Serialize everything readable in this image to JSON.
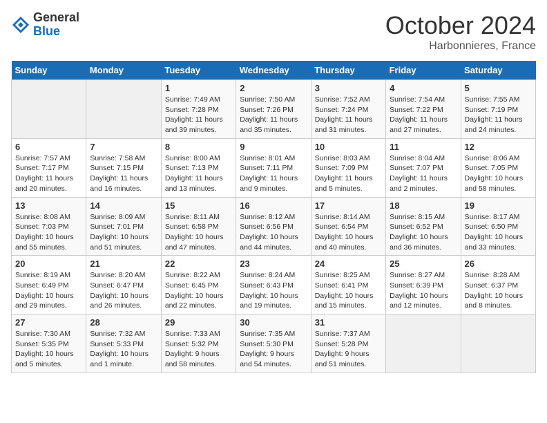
{
  "header": {
    "logo_general": "General",
    "logo_blue": "Blue",
    "month": "October 2024",
    "location": "Harbonnieres, France"
  },
  "days_of_week": [
    "Sunday",
    "Monday",
    "Tuesday",
    "Wednesday",
    "Thursday",
    "Friday",
    "Saturday"
  ],
  "weeks": [
    [
      {
        "day": "",
        "sunrise": "",
        "sunset": "",
        "daylight": ""
      },
      {
        "day": "",
        "sunrise": "",
        "sunset": "",
        "daylight": ""
      },
      {
        "day": "1",
        "sunrise": "Sunrise: 7:49 AM",
        "sunset": "Sunset: 7:28 PM",
        "daylight": "Daylight: 11 hours and 39 minutes."
      },
      {
        "day": "2",
        "sunrise": "Sunrise: 7:50 AM",
        "sunset": "Sunset: 7:26 PM",
        "daylight": "Daylight: 11 hours and 35 minutes."
      },
      {
        "day": "3",
        "sunrise": "Sunrise: 7:52 AM",
        "sunset": "Sunset: 7:24 PM",
        "daylight": "Daylight: 11 hours and 31 minutes."
      },
      {
        "day": "4",
        "sunrise": "Sunrise: 7:54 AM",
        "sunset": "Sunset: 7:22 PM",
        "daylight": "Daylight: 11 hours and 27 minutes."
      },
      {
        "day": "5",
        "sunrise": "Sunrise: 7:55 AM",
        "sunset": "Sunset: 7:19 PM",
        "daylight": "Daylight: 11 hours and 24 minutes."
      }
    ],
    [
      {
        "day": "6",
        "sunrise": "Sunrise: 7:57 AM",
        "sunset": "Sunset: 7:17 PM",
        "daylight": "Daylight: 11 hours and 20 minutes."
      },
      {
        "day": "7",
        "sunrise": "Sunrise: 7:58 AM",
        "sunset": "Sunset: 7:15 PM",
        "daylight": "Daylight: 11 hours and 16 minutes."
      },
      {
        "day": "8",
        "sunrise": "Sunrise: 8:00 AM",
        "sunset": "Sunset: 7:13 PM",
        "daylight": "Daylight: 11 hours and 13 minutes."
      },
      {
        "day": "9",
        "sunrise": "Sunrise: 8:01 AM",
        "sunset": "Sunset: 7:11 PM",
        "daylight": "Daylight: 11 hours and 9 minutes."
      },
      {
        "day": "10",
        "sunrise": "Sunrise: 8:03 AM",
        "sunset": "Sunset: 7:09 PM",
        "daylight": "Daylight: 11 hours and 5 minutes."
      },
      {
        "day": "11",
        "sunrise": "Sunrise: 8:04 AM",
        "sunset": "Sunset: 7:07 PM",
        "daylight": "Daylight: 11 hours and 2 minutes."
      },
      {
        "day": "12",
        "sunrise": "Sunrise: 8:06 AM",
        "sunset": "Sunset: 7:05 PM",
        "daylight": "Daylight: 10 hours and 58 minutes."
      }
    ],
    [
      {
        "day": "13",
        "sunrise": "Sunrise: 8:08 AM",
        "sunset": "Sunset: 7:03 PM",
        "daylight": "Daylight: 10 hours and 55 minutes."
      },
      {
        "day": "14",
        "sunrise": "Sunrise: 8:09 AM",
        "sunset": "Sunset: 7:01 PM",
        "daylight": "Daylight: 10 hours and 51 minutes."
      },
      {
        "day": "15",
        "sunrise": "Sunrise: 8:11 AM",
        "sunset": "Sunset: 6:58 PM",
        "daylight": "Daylight: 10 hours and 47 minutes."
      },
      {
        "day": "16",
        "sunrise": "Sunrise: 8:12 AM",
        "sunset": "Sunset: 6:56 PM",
        "daylight": "Daylight: 10 hours and 44 minutes."
      },
      {
        "day": "17",
        "sunrise": "Sunrise: 8:14 AM",
        "sunset": "Sunset: 6:54 PM",
        "daylight": "Daylight: 10 hours and 40 minutes."
      },
      {
        "day": "18",
        "sunrise": "Sunrise: 8:15 AM",
        "sunset": "Sunset: 6:52 PM",
        "daylight": "Daylight: 10 hours and 36 minutes."
      },
      {
        "day": "19",
        "sunrise": "Sunrise: 8:17 AM",
        "sunset": "Sunset: 6:50 PM",
        "daylight": "Daylight: 10 hours and 33 minutes."
      }
    ],
    [
      {
        "day": "20",
        "sunrise": "Sunrise: 8:19 AM",
        "sunset": "Sunset: 6:49 PM",
        "daylight": "Daylight: 10 hours and 29 minutes."
      },
      {
        "day": "21",
        "sunrise": "Sunrise: 8:20 AM",
        "sunset": "Sunset: 6:47 PM",
        "daylight": "Daylight: 10 hours and 26 minutes."
      },
      {
        "day": "22",
        "sunrise": "Sunrise: 8:22 AM",
        "sunset": "Sunset: 6:45 PM",
        "daylight": "Daylight: 10 hours and 22 minutes."
      },
      {
        "day": "23",
        "sunrise": "Sunrise: 8:24 AM",
        "sunset": "Sunset: 6:43 PM",
        "daylight": "Daylight: 10 hours and 19 minutes."
      },
      {
        "day": "24",
        "sunrise": "Sunrise: 8:25 AM",
        "sunset": "Sunset: 6:41 PM",
        "daylight": "Daylight: 10 hours and 15 minutes."
      },
      {
        "day": "25",
        "sunrise": "Sunrise: 8:27 AM",
        "sunset": "Sunset: 6:39 PM",
        "daylight": "Daylight: 10 hours and 12 minutes."
      },
      {
        "day": "26",
        "sunrise": "Sunrise: 8:28 AM",
        "sunset": "Sunset: 6:37 PM",
        "daylight": "Daylight: 10 hours and 8 minutes."
      }
    ],
    [
      {
        "day": "27",
        "sunrise": "Sunrise: 7:30 AM",
        "sunset": "Sunset: 5:35 PM",
        "daylight": "Daylight: 10 hours and 5 minutes."
      },
      {
        "day": "28",
        "sunrise": "Sunrise: 7:32 AM",
        "sunset": "Sunset: 5:33 PM",
        "daylight": "Daylight: 10 hours and 1 minute."
      },
      {
        "day": "29",
        "sunrise": "Sunrise: 7:33 AM",
        "sunset": "Sunset: 5:32 PM",
        "daylight": "Daylight: 9 hours and 58 minutes."
      },
      {
        "day": "30",
        "sunrise": "Sunrise: 7:35 AM",
        "sunset": "Sunset: 5:30 PM",
        "daylight": "Daylight: 9 hours and 54 minutes."
      },
      {
        "day": "31",
        "sunrise": "Sunrise: 7:37 AM",
        "sunset": "Sunset: 5:28 PM",
        "daylight": "Daylight: 9 hours and 51 minutes."
      },
      {
        "day": "",
        "sunrise": "",
        "sunset": "",
        "daylight": ""
      },
      {
        "day": "",
        "sunrise": "",
        "sunset": "",
        "daylight": ""
      }
    ]
  ]
}
